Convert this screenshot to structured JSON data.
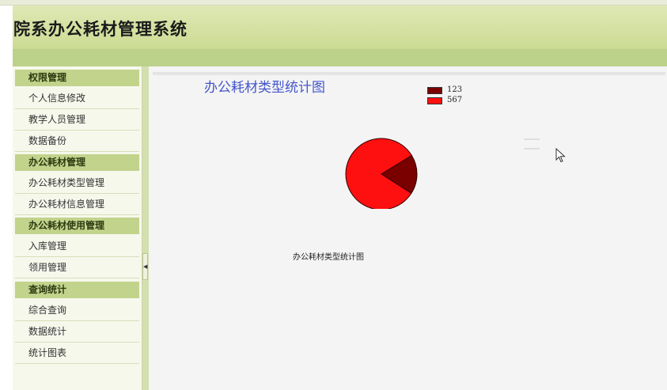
{
  "header": {
    "title": "院系办公耗材管理系统"
  },
  "sidebar": {
    "groups": [
      {
        "label": "权限管理",
        "items": [
          "个人信息修改",
          "教学人员管理",
          "数据备份"
        ]
      },
      {
        "label": "办公耗材管理",
        "items": [
          "办公耗材类型管理",
          "办公耗材信息管理"
        ]
      },
      {
        "label": "办公耗材使用管理",
        "items": [
          "入库管理",
          "领用管理"
        ]
      },
      {
        "label": "查询统计",
        "items": [
          "综合查询",
          "数据统计",
          "统计图表"
        ]
      }
    ]
  },
  "splitter": {
    "icon": "collapse-left-icon"
  },
  "main": {
    "chart_title": "办公耗材类型统计图",
    "caption": "办公耗材类型统计图"
  },
  "chart_data": {
    "type": "pie",
    "title": "办公耗材类型统计图",
    "legend": [
      "123",
      "567"
    ],
    "values": [
      123,
      567
    ],
    "colors": [
      "#7a0000",
      "#ff1010"
    ],
    "legend_position": "top-right"
  }
}
